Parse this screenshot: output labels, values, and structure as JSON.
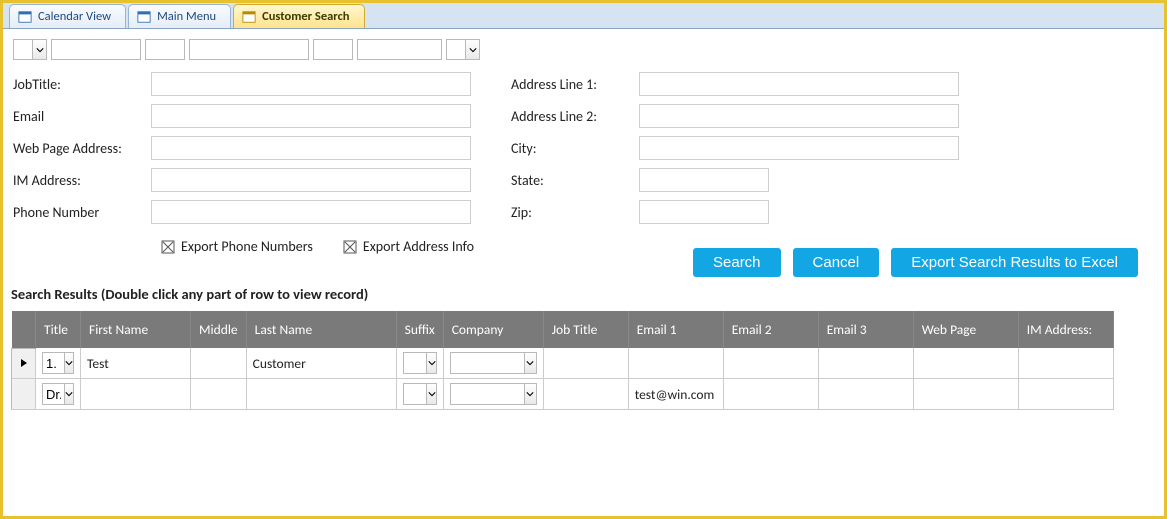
{
  "tabs": [
    {
      "label": "Calendar View",
      "active": false
    },
    {
      "label": "Main Menu",
      "active": false
    },
    {
      "label": "Customer Search",
      "active": true
    }
  ],
  "form": {
    "left": {
      "job_title_label": "JobTitle:",
      "email_label": "Email",
      "web_page_label": "Web Page Address:",
      "im_label": "IM Address:",
      "phone_label": "Phone Number"
    },
    "right": {
      "addr1_label": "Address Line 1:",
      "addr2_label": "Address Line 2:",
      "city_label": "City:",
      "state_label": "State:",
      "zip_label": "Zip:"
    }
  },
  "export": {
    "phone_label": "Export Phone Numbers",
    "address_label": "Export Address Info"
  },
  "buttons": {
    "search": "Search",
    "cancel": "Cancel",
    "excel": "Export Search Results to Excel"
  },
  "results_heading": "Search Results (Double click any part of row to view record)",
  "columns": {
    "title": "Title",
    "first": "First Name",
    "middle": "Middle",
    "last": "Last Name",
    "suffix": "Suffix",
    "company": "Company",
    "jobtitle": "Job Title",
    "e1": "Email 1",
    "e2": "Email 2",
    "e3": "Email 3",
    "web": "Web Page",
    "im": "IM Address:"
  },
  "rows": [
    {
      "selected": true,
      "title": "1.",
      "first": "Test",
      "middle": "",
      "last": "Customer",
      "suffix": "",
      "company": "",
      "jobtitle": "",
      "e1": "",
      "e2": "",
      "e3": "",
      "web": "",
      "im": ""
    },
    {
      "selected": false,
      "title": "Dr.",
      "first": "",
      "middle": "",
      "last": "",
      "suffix": "",
      "company": "",
      "jobtitle": "",
      "e1": "test@win.com",
      "e2": "",
      "e3": "",
      "web": "",
      "im": ""
    }
  ]
}
